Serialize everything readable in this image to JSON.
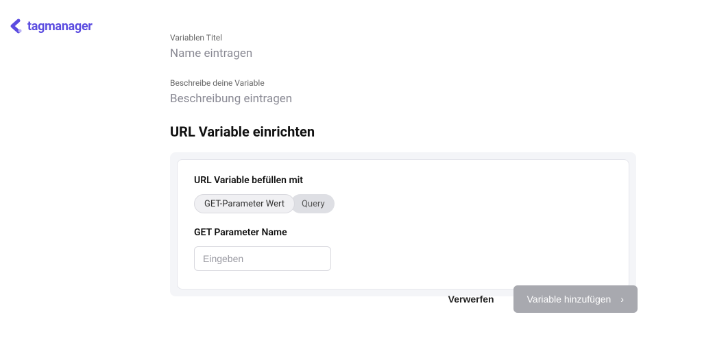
{
  "logo": {
    "text": "tagmanager"
  },
  "fields": {
    "title_label": "Variablen Titel",
    "title_value": "Name eintragen",
    "desc_label": "Beschreibe deine Variable",
    "desc_value": "Beschreibung eintragen"
  },
  "section_title": "URL Variable einrichten",
  "card": {
    "fill_label": "URL Variable befüllen mit",
    "chip_primary": "GET-Parameter Wert",
    "chip_secondary": "Query",
    "param_label": "GET Parameter Name",
    "param_placeholder": "Eingeben"
  },
  "footer": {
    "discard": "Verwerfen",
    "submit": "Variable hinzufügen"
  }
}
